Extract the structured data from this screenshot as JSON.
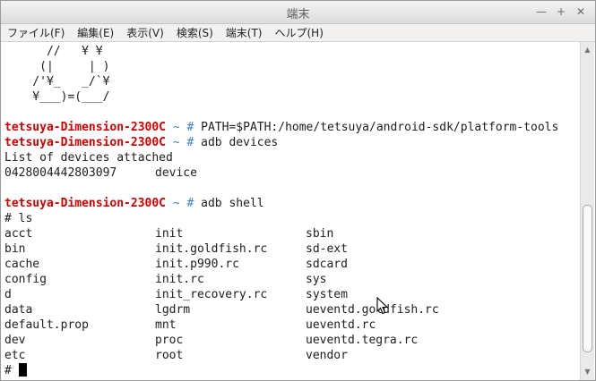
{
  "window": {
    "title": "端末"
  },
  "menu": [
    "ファイル(F)",
    "編集(E)",
    "表示(V)",
    "検索(S)",
    "端末(T)",
    "ヘルプ(H)"
  ],
  "ascii_art": [
    "      //   ¥ ¥",
    "     (|     | )",
    "    /'¥_   _/`¥",
    "    ¥___)=(___/"
  ],
  "prompt": {
    "host": "tetsuya-Dimension-2300C",
    "tilde": " ~",
    "hash": "#"
  },
  "commands": {
    "path": " PATH=$PATH:/home/tetsuya/android-sdk/platform-tools",
    "devices": " adb devices",
    "shell": " adb shell"
  },
  "devices_output": {
    "header": "List of devices attached",
    "serial": "0428004442803097",
    "state": "device"
  },
  "shell_prompt": "# ls",
  "ls_rows": [
    [
      "acct",
      "init",
      "sbin"
    ],
    [
      "bin",
      "init.goldfish.rc",
      "sd-ext"
    ],
    [
      "cache",
      "init.p990.rc",
      "sdcard"
    ],
    [
      "config",
      "init.rc",
      "sys"
    ],
    [
      "d",
      "init_recovery.rc",
      "system"
    ],
    [
      "data",
      "lgdrm",
      "ueventd.goldfish.rc"
    ],
    [
      "default.prop",
      "mnt",
      "ueventd.rc"
    ],
    [
      "dev",
      "proc",
      "ueventd.tegra.rc"
    ],
    [
      "etc",
      "root",
      "vendor"
    ]
  ],
  "final_prompt": "# "
}
